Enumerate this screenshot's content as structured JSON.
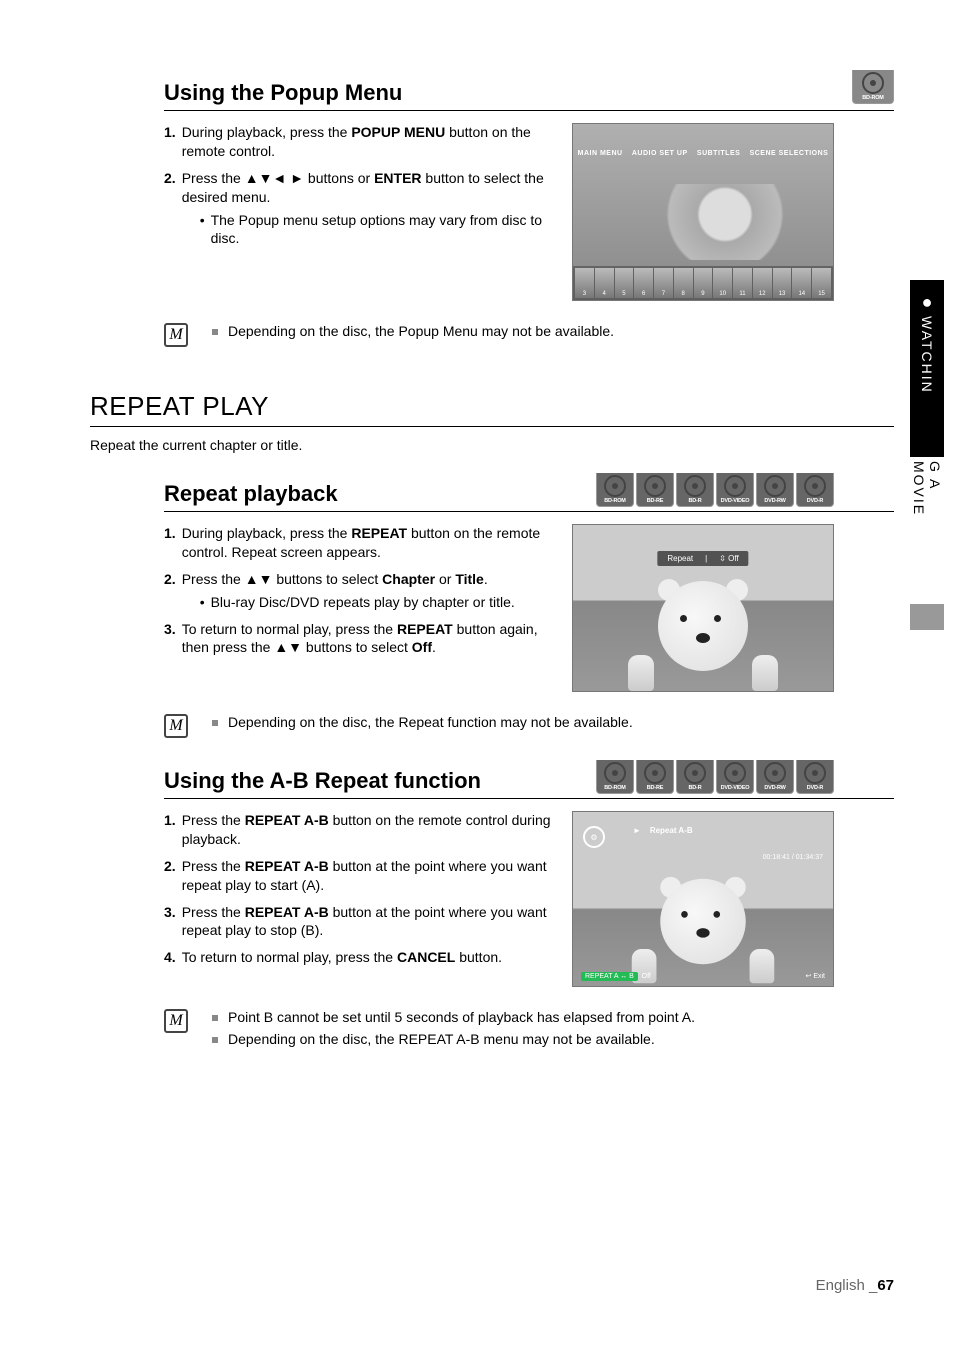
{
  "side": {
    "chapter": "WATCHING A MOVIE",
    "bullet": "●"
  },
  "disc_labels": [
    "BD-ROM",
    "BD-RE",
    "BD-R",
    "DVD-VIDEO",
    "DVD-RW",
    "DVD-R"
  ],
  "sec1": {
    "title": "Using the Popup Menu",
    "s1_num": "1.",
    "s1_a": "During playback, press the ",
    "s1_b": "POPUP MENU",
    "s1_c": " button on the remote control.",
    "s2_num": "2.",
    "s2_a": "Press the ",
    "arrows4": "▲▼◄ ►",
    "s2_b": " buttons or ",
    "s2_c": "ENTER",
    "s2_d": " button to select the desired menu.",
    "sub_a": "The Popup menu setup options may vary from disc to disc.",
    "note": "Depending on the disc, the Popup Menu may not be available.",
    "menu_items": [
      "MAIN MENU",
      "AUDIO SET UP",
      "SUBTITLES",
      "SCENE SELECTIONS"
    ],
    "thumb_nums": [
      "3",
      "4",
      "5",
      "6",
      "7",
      "8",
      "9",
      "10",
      "11",
      "12",
      "13",
      "14",
      "15"
    ]
  },
  "sec2": {
    "title": "REPEAT PLAY",
    "intro": "Repeat the current chapter or title."
  },
  "sec3": {
    "title": "Repeat playback",
    "s1_num": "1.",
    "s1_a": "During playback, press the ",
    "s1_b": "REPEAT",
    "s1_c": " button on the remote control. Repeat screen appears.",
    "s2_num": "2.",
    "s2_a": "Press the ",
    "arrows2": "▲▼",
    "s2_b": " buttons to select ",
    "s2_c": "Chapter",
    "s2_or": " or ",
    "s2_d": "Title",
    "s2_e": ".",
    "sub_a": "Blu-ray Disc/DVD repeats play by chapter or title.",
    "s3_num": "3.",
    "s3_a": "To return to normal play, press the ",
    "s3_b": "REPEAT",
    "s3_c": " button again, then press the ",
    "s3_d": " buttons to select ",
    "s3_e": "Off",
    "s3_f": ".",
    "osd_repeat": "Repeat",
    "osd_sep": "|",
    "osd_off": "⇳ Off",
    "note": "Depending on the disc, the Repeat function may not be available."
  },
  "sec4": {
    "title": "Using the A-B Repeat function",
    "s1_num": "1.",
    "s1_a": "Press the ",
    "s1_b": "REPEAT A-B",
    "s1_c": " button on the remote control during playback.",
    "s2_num": "2.",
    "s2_a": "Press the  ",
    "s2_b": "REPEAT A-B",
    "s2_c": " button at the point where you want repeat play to start (A).",
    "s3_num": "3.",
    "s3_a": "Press the  ",
    "s3_b": "REPEAT A-B",
    "s3_c": " button at the point where you want repeat play to stop (B).",
    "s4_num": "4.",
    "s4_a": "To return to normal play, press the ",
    "s4_b": "CANCEL",
    "s4_c": " button.",
    "osd_play": "►",
    "osd_title": "Repeat A-B",
    "osd_time": "00:18:41 / 01:34:37",
    "osd_ab": "REPEAT A ↔ B",
    "osd_off": "Off",
    "osd_exit": "Exit",
    "note1": "Point B cannot be set until 5 seconds of playback has elapsed from point A.",
    "note2": "Depending on the disc, the REPEAT A-B menu may not be available."
  },
  "footer": {
    "lang": "English ",
    "sep": "_",
    "page": "67"
  }
}
